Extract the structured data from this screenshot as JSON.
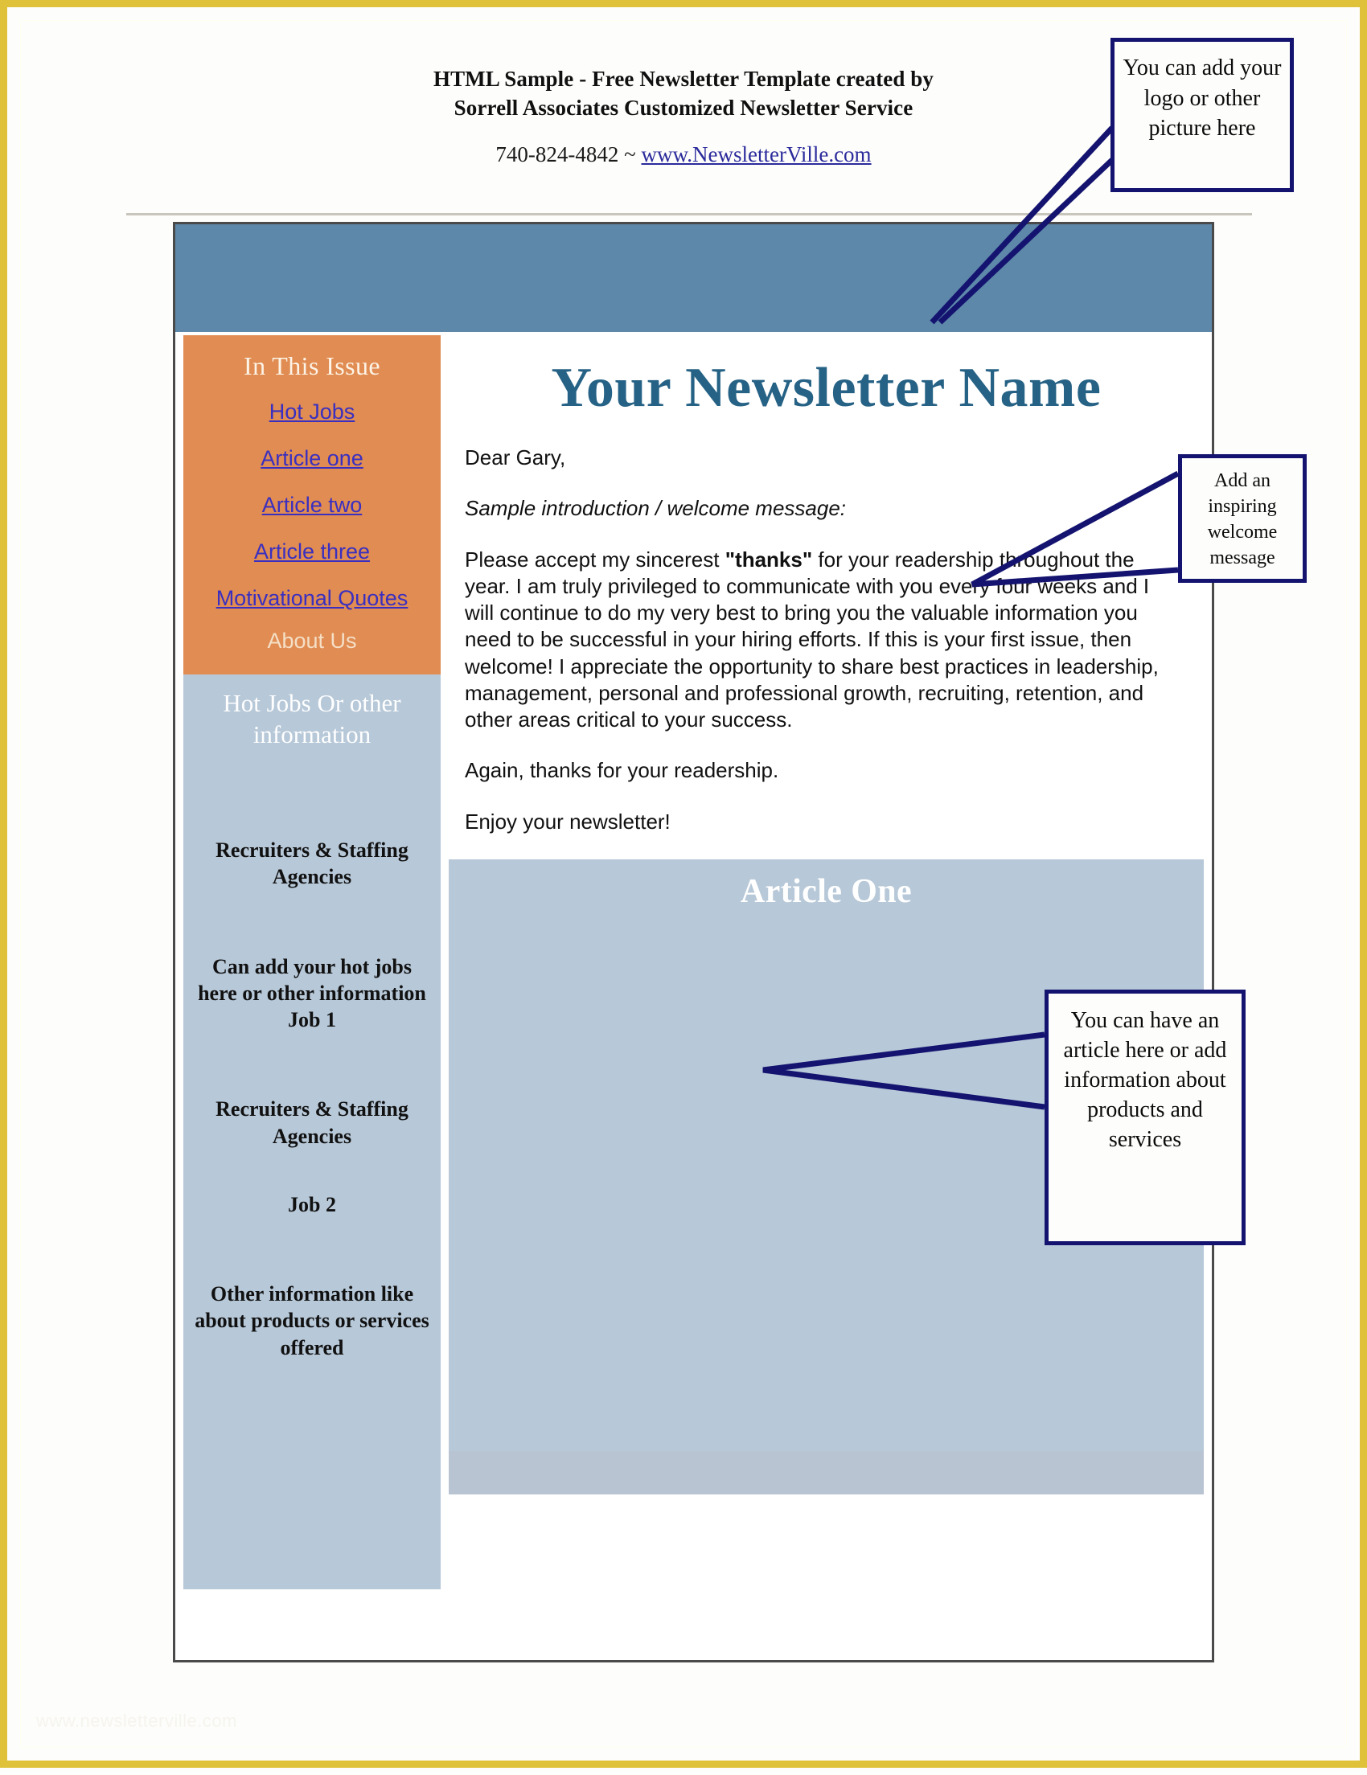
{
  "document": {
    "header": {
      "line1": "HTML Sample - Free Newsletter Template created by",
      "line2": "Sorrell Associates Customized Newsletter Service",
      "phone": "740-824-4842 ~ ",
      "website": "www.NewsletterVille.com"
    },
    "watermark": "www.newsletterville.com"
  },
  "newsletter": {
    "title": "Your Newsletter Name",
    "sidebar": {
      "issue_heading": "In This Issue",
      "links": [
        {
          "label": "Hot Jobs"
        },
        {
          "label": "Article one"
        },
        {
          "label": "Article two"
        },
        {
          "label": "Article three"
        },
        {
          "label": "Motivational Quotes"
        }
      ],
      "about_us": "About Us",
      "hotjobs_heading": "Hot Jobs Or other information",
      "blocks": [
        "Recruiters & Staffing Agencies",
        "Can add your hot jobs here or other information\nJob 1",
        "Recruiters & Staffing Agencies",
        "Job 2",
        "Other information like about products or services offered"
      ]
    },
    "body": {
      "salutation": "Dear Gary,",
      "intro_italic": "Sample introduction / welcome message:",
      "paragraph_pre": "Please accept my sincerest ",
      "paragraph_bold": "\"thanks\"",
      "paragraph_post": " for your readership throughout the year. I am truly privileged to communicate with you every four weeks and I will continue to do my very best to bring you the valuable information you need to be successful in your hiring efforts. If this is your first issue, then welcome! I appreciate the opportunity to share best practices in leadership, management, personal and professional growth, recruiting, retention, and other areas critical to your success.",
      "closing1": "Again, thanks for your readership.",
      "closing2": "Enjoy your newsletter!"
    },
    "article_one": {
      "title": "Article One"
    }
  },
  "callouts": {
    "logo": "You can add your logo or other picture here",
    "welcome": "Add an inspiring welcome message",
    "article": "You can have an article here or add information about products and services"
  },
  "colors": {
    "page_border": "#dfc23a",
    "masthead_blue": "#5d88aa",
    "sidebar_orange": "#e08c52",
    "sidebar_lightblue": "#b7c8d8",
    "title_blue": "#266285",
    "link_purple": "#3a2fc0",
    "callout_border": "#141470"
  }
}
